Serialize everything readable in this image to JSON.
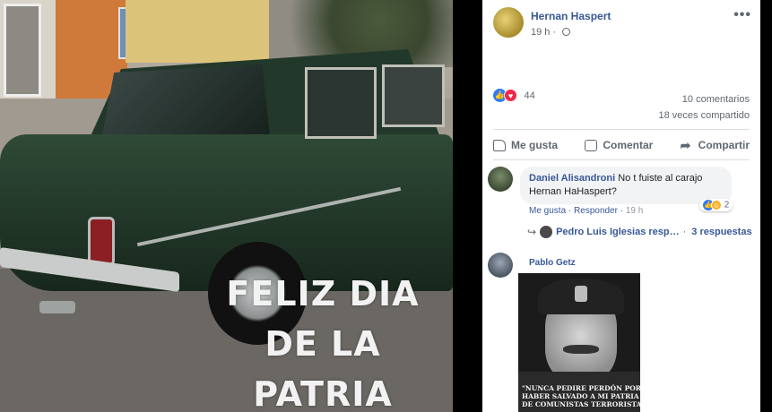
{
  "photo": {
    "overlay_lines": [
      "FELIZ DIA",
      "DE LA",
      "PATRIA"
    ]
  },
  "post": {
    "author": "Hernan Haspert",
    "time": "19 h",
    "more_label": "•••",
    "reaction_count": "44",
    "comments_count": "10 comentarios",
    "shares_count": "18 veces compartido",
    "actions": {
      "like": "Me gusta",
      "comment": "Comentar",
      "share": "Compartir"
    }
  },
  "comments": [
    {
      "author": "Daniel Alisandroni",
      "text_line1": "No t fuiste al carajo",
      "text_line2": "Hernan HaHaspert?",
      "like_label": "Me gusta",
      "reply_label": "Responder",
      "time": "19 h",
      "reaction_count": "2"
    },
    {
      "author": "Pablo Getz",
      "meme_caption_line1": "\"NUNCA PEDIRE PERDÓN POR",
      "meme_caption_line2": "HABER SALVADO A MI PATRIA",
      "meme_caption_line3": "DE COMUNISTAS TERRORISTAS"
    }
  ],
  "replies": {
    "author": "Pedro Luis Iglesias resp…",
    "separator": "·",
    "count_label": "3 respuestas"
  },
  "colors": {
    "link_blue": "#385898",
    "like_blue": "#2f7cf6",
    "love_red": "#f0284a",
    "haha_yellow": "#f7b125"
  }
}
